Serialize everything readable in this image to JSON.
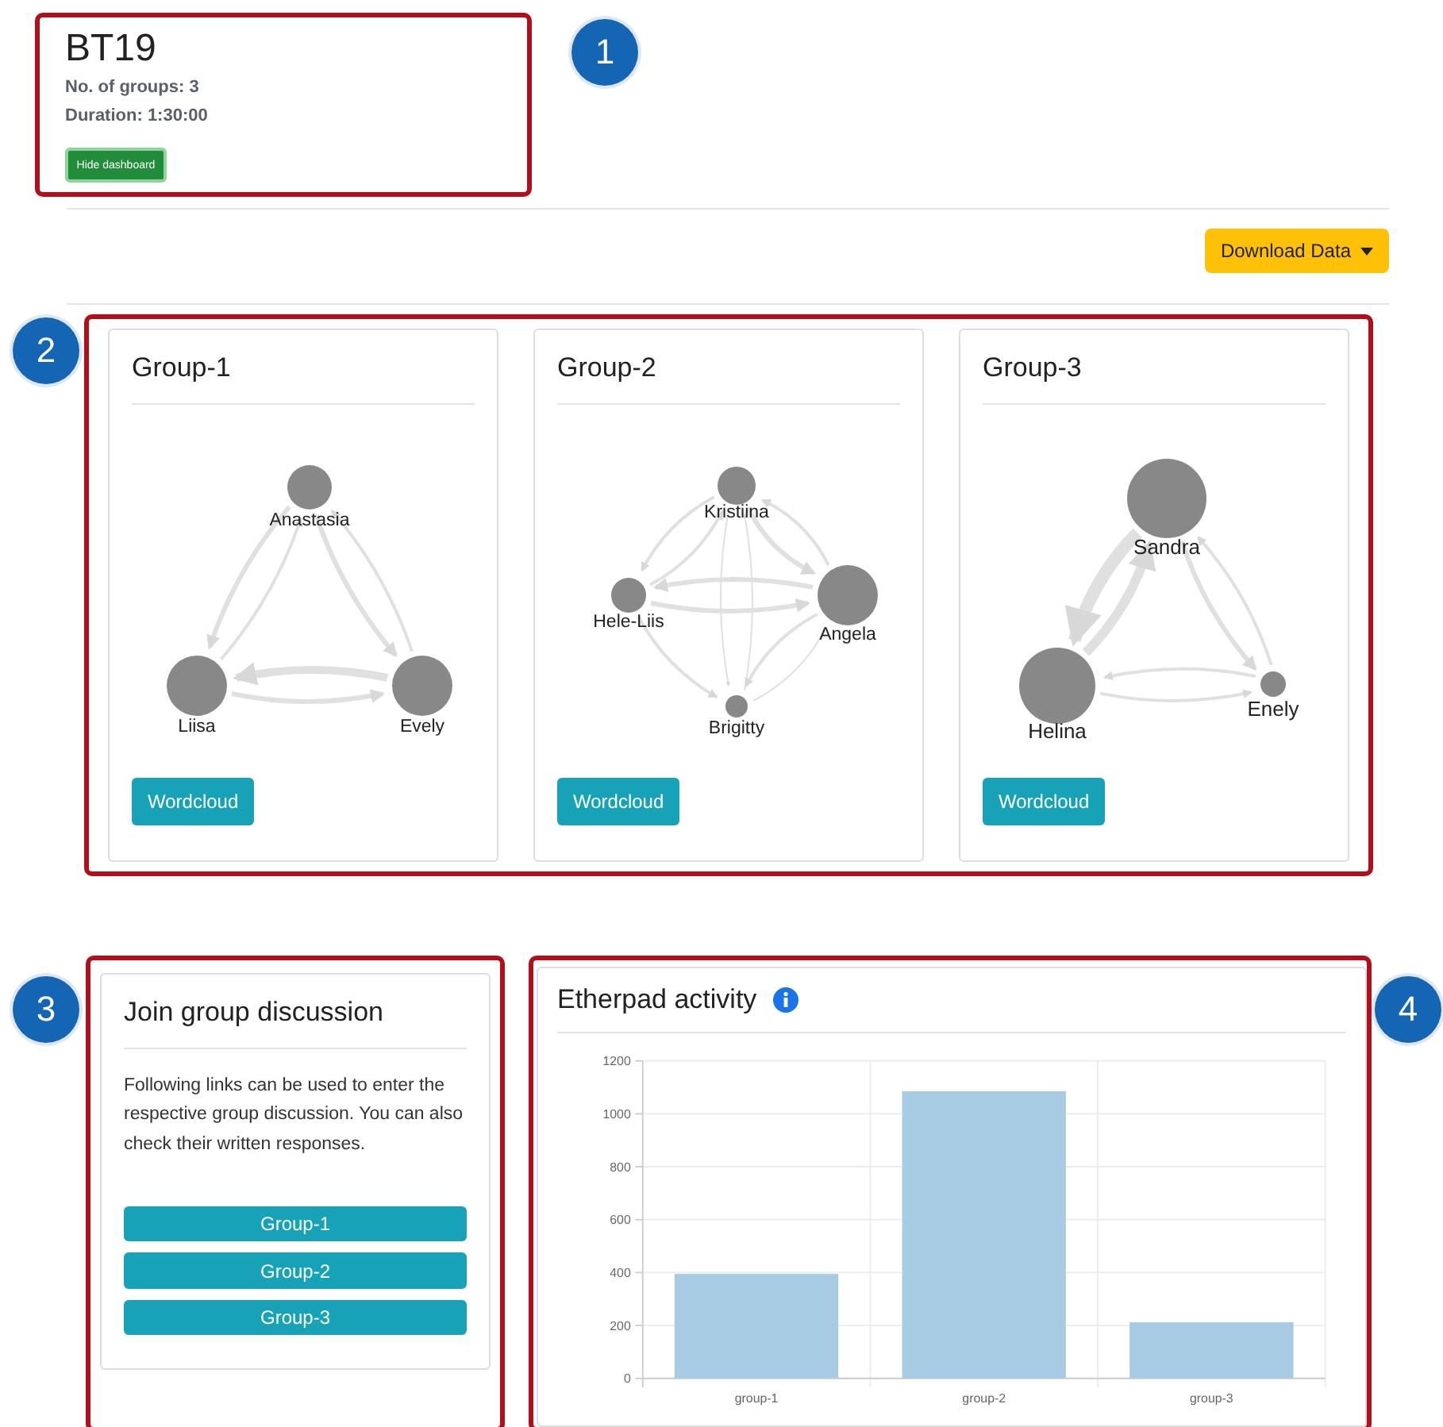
{
  "header": {
    "title": "BT19",
    "details": [
      "No. of groups: 3",
      "Duration: 1:30:00"
    ],
    "hide_button": "Hide dashboard"
  },
  "download_button": "Download Data",
  "groups": [
    {
      "title": "Group-1",
      "members": [
        "Anastasia",
        "Liisa",
        "Evely"
      ],
      "button": "Wordcloud"
    },
    {
      "title": "Group-2",
      "members": [
        "Kristiina",
        "Hele-Liis",
        "Angela",
        "Brigitty"
      ],
      "button": "Wordcloud"
    },
    {
      "title": "Group-3",
      "members": [
        "Sandra",
        "Helina",
        "Enely"
      ],
      "button": "Wordcloud"
    }
  ],
  "join": {
    "title": "Join group discussion",
    "text": "Following links can be used to enter the respective group discussion. You can also check their written responses.",
    "links": [
      "Group-1",
      "Group-2",
      "Group-3"
    ]
  },
  "etherpad": {
    "title": "Etherpad activity",
    "chart_data": {
      "type": "bar",
      "categories": [
        "group-1",
        "group-2",
        "group-3"
      ],
      "values": [
        395,
        1085,
        212
      ],
      "ylim": [
        0,
        1200
      ],
      "yticks": [
        0,
        200,
        400,
        600,
        800,
        1000,
        1200
      ],
      "grid": true
    }
  },
  "callouts": [
    "1",
    "2",
    "3",
    "4"
  ]
}
